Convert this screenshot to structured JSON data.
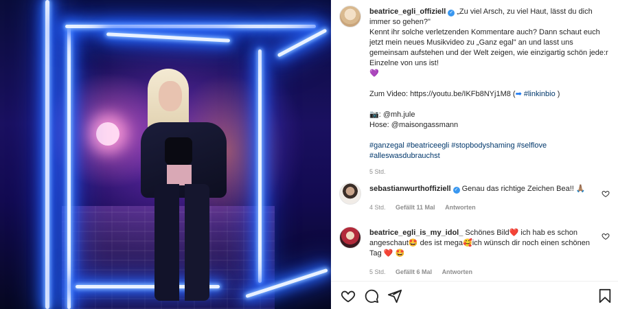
{
  "post": {
    "username": "beatrice_egli_offiziell",
    "caption_lines": [
      "„Zu viel Arsch, zu viel Haut, lässt du dich immer so gehen?\"",
      "Kennt ihr solche verletzenden Kommentare auch? Dann schaut euch jetzt mein neues Musikvideo zu „Ganz egal\" an und lasst uns gemeinsam aufstehen und der Welt zeigen, wie einzigartig schön jede:r Einzelne von uns ist!"
    ],
    "video_line": "Zum Video: https://youtu.be/IKFb8NYj1M8 (",
    "video_arrow": "➡",
    "video_tag": "#linkinbio",
    "video_close": ")",
    "camera_emoji": "📷",
    "photo_credit": ": @mh.jule",
    "hose_credit": "Hose: @maisongassmann",
    "hashtags": "#ganzegal #beatriceegli #stopbodyshaming #selflove #alleswasdubrauchst",
    "time": "5 Std."
  },
  "comments": [
    {
      "username": "sebastianwurthoffiziell",
      "text": "Genau das richtige Zeichen Bea!!",
      "emoji": "🙏🏽",
      "time": "4 Std.",
      "likes": "Gefällt 11 Mal",
      "reply": "Antworten"
    },
    {
      "username": "beatrice_egli_is_my_idol_",
      "text_parts": [
        "Schönes Bild",
        "❤️",
        " ich hab es schon angeschaut",
        "🤩",
        " des ist mega",
        "🥰",
        "ich wünsch dir noch einen schönen Tag ",
        "❤️",
        " ",
        "🤩"
      ],
      "time": "5 Std.",
      "likes": "Gefällt 6 Mal",
      "reply": "Antworten"
    }
  ],
  "icons": {
    "like": "heart-icon",
    "comment": "comment-icon",
    "share": "share-icon",
    "save": "bookmark-icon",
    "verified": "verified-badge-icon"
  },
  "colors": {
    "verified": "#3897f0",
    "link": "#00376b",
    "meta": "#8e8e8e"
  }
}
